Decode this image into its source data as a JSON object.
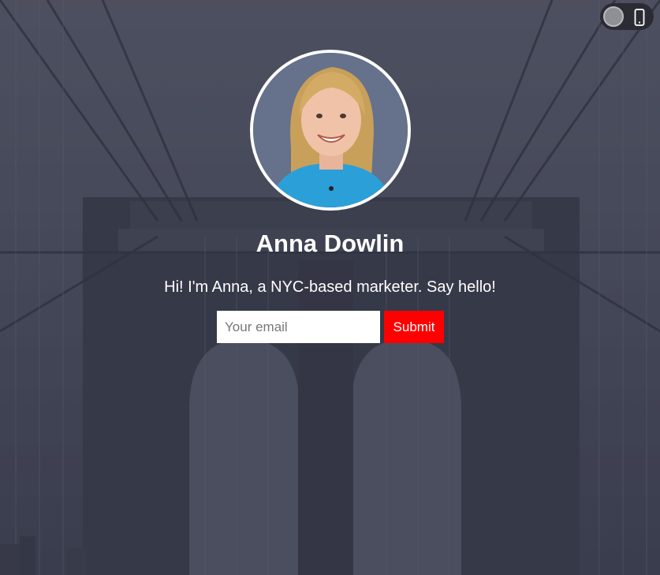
{
  "theme": {
    "accent": "#ff0000",
    "background_tint": "#4a4d5c"
  },
  "background": {
    "image_icon": "bridge-photo"
  },
  "view_toggle": {
    "icon": "mobile-phone-icon"
  },
  "profile": {
    "avatar_icon": "profile-photo",
    "name": "Anna Dowlin",
    "bio": "Hi! I'm Anna, a NYC-based marketer. Say hello!"
  },
  "signup": {
    "email_placeholder": "Your email",
    "email_value": "",
    "submit_label": "Submit"
  }
}
